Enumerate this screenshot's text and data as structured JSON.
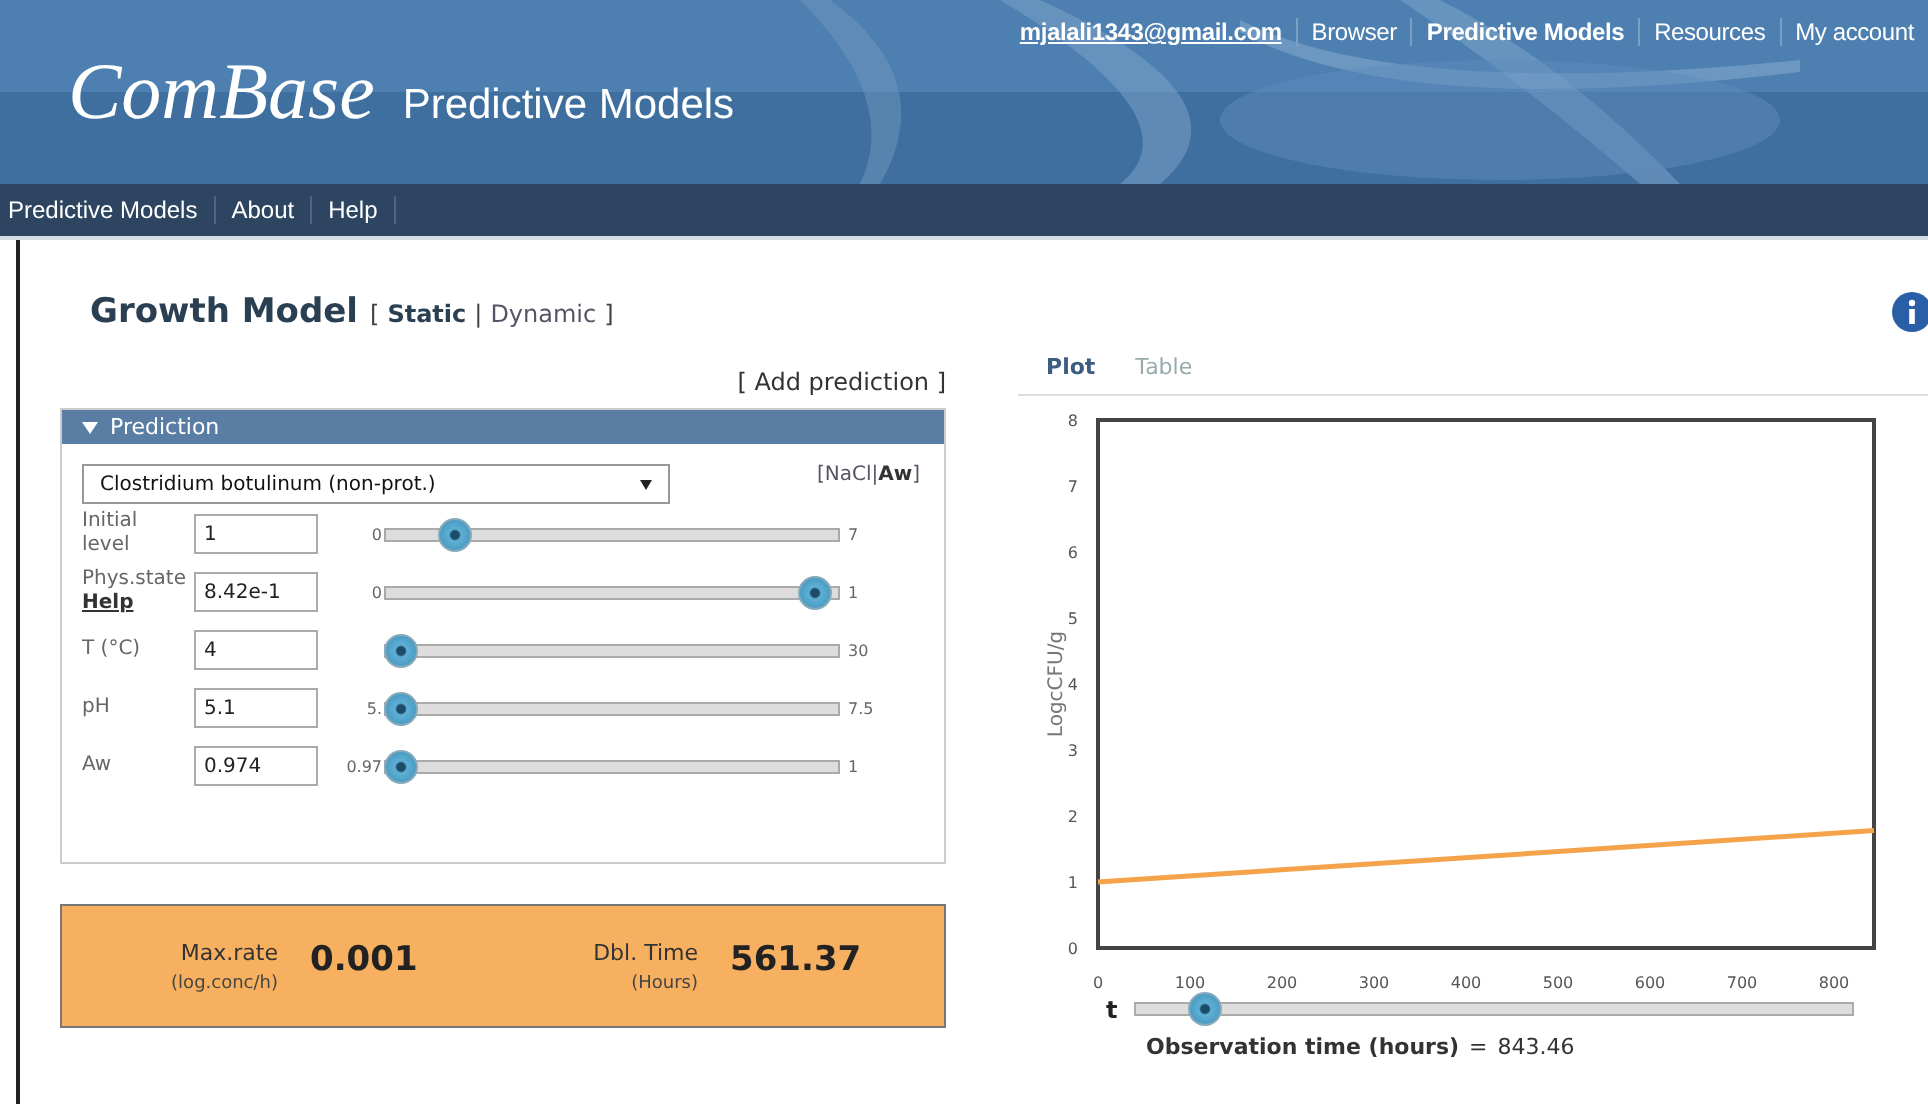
{
  "header": {
    "logo": "ComBase",
    "subtitle": "Predictive Models",
    "top_links": [
      {
        "label": "mjalali1343@gmail.com",
        "kind": "account",
        "selected": false
      },
      {
        "label": "Browser",
        "kind": "link",
        "selected": false
      },
      {
        "label": "Predictive Models",
        "kind": "link",
        "selected": true
      },
      {
        "label": "Resources",
        "kind": "link",
        "selected": false
      },
      {
        "label": "My account",
        "kind": "link",
        "selected": false
      }
    ]
  },
  "nav": [
    "Predictive Models",
    "About",
    "Help"
  ],
  "page": {
    "title": "Growth Model",
    "open": "[",
    "close": "]",
    "separator": "|",
    "modes": [
      {
        "label": "Static",
        "selected": true
      },
      {
        "label": "Dynamic",
        "selected": false
      }
    ]
  },
  "add_prediction": "[ Add prediction ]",
  "panel": {
    "title": "Prediction",
    "expanded": true,
    "organism": "Clostridium botulinum (non-prot.)",
    "factor_toggle": {
      "open": "[",
      "close": "]",
      "separator": "|",
      "options": [
        {
          "label": "NaCl",
          "selected": false
        },
        {
          "label": "Aw",
          "selected": true
        }
      ]
    },
    "parameters": [
      {
        "label": "Initial level",
        "value": "1",
        "min": "0",
        "max": "7",
        "level": 0.13
      },
      {
        "label": "Phys.state",
        "help": "Help",
        "value": "8.42e-1",
        "min": "0",
        "max": "1",
        "level": 0.98
      },
      {
        "label": "T (°C)",
        "value": "4",
        "max": "30",
        "level": 0
      },
      {
        "label": "pH",
        "value": "5.1",
        "min": "5.",
        "max": "7.5",
        "level": 0
      },
      {
        "label": "Aw",
        "value": "0.974",
        "min": "0.97",
        "max": "1",
        "level": 0
      }
    ]
  },
  "results": [
    {
      "label": "Max.rate",
      "unit": "(log.conc/h)",
      "value": "0.001"
    },
    {
      "label": "Dbl. Time",
      "unit": "(Hours)",
      "value": "561.37"
    }
  ],
  "tabs": [
    {
      "label": "Plot",
      "selected": true
    },
    {
      "label": "Table",
      "selected": false
    }
  ],
  "chart": {
    "chart_data": {
      "type": "line",
      "ylabel": "LogcCFU/g",
      "x": [
        0,
        843.46
      ],
      "xlim": [
        0,
        843.46
      ],
      "ylim": [
        0,
        8
      ],
      "xticks": [
        0,
        100,
        200,
        300,
        400,
        500,
        600,
        700,
        800
      ],
      "yticks": [
        0,
        1,
        2,
        3,
        4,
        5,
        6,
        7,
        8
      ],
      "series": [
        {
          "color": "#f5a34a",
          "values": [
            1.0,
            1.78
          ]
        }
      ]
    }
  },
  "time_slider": {
    "label": "t",
    "level": 0.08
  },
  "observation": {
    "label": "Observation time (hours)",
    "equals": "=",
    "value": "843.46"
  }
}
